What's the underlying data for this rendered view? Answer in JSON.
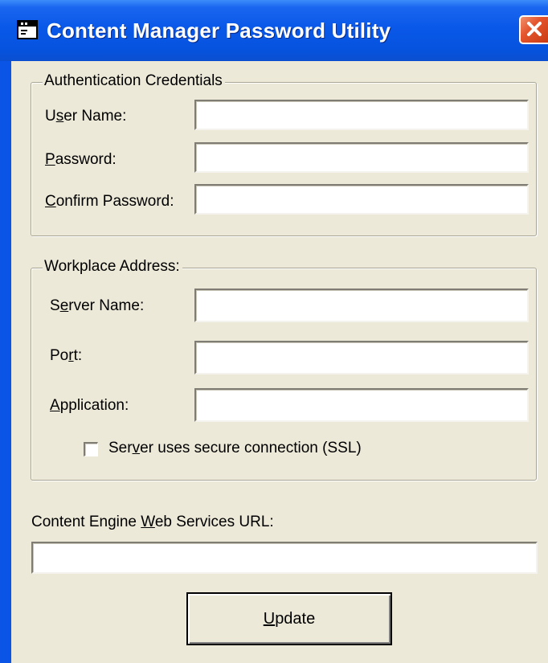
{
  "window": {
    "title": "Content Manager Password Utility",
    "icons": {
      "app": "window-app-icon",
      "close": "close-x-icon"
    },
    "colors": {
      "titlebar": "#0a58e8",
      "close_button": "#e4552e",
      "client": "#ece9d8"
    }
  },
  "auth_group": {
    "legend": "Authentication Credentials",
    "user_name": {
      "pre": "U",
      "key": "s",
      "post": "er Name:",
      "value": ""
    },
    "password": {
      "pre": "",
      "key": "P",
      "post": "assword:",
      "value": ""
    },
    "confirm_password": {
      "pre": "",
      "key": "C",
      "post": "onfirm Password:",
      "value": ""
    }
  },
  "workplace_group": {
    "legend": "Workplace Address:",
    "server_name": {
      "pre": "S",
      "key": "e",
      "post": "rver Name:",
      "value": ""
    },
    "port": {
      "pre": "Po",
      "key": "r",
      "post": "t:",
      "value": ""
    },
    "application": {
      "pre": "",
      "key": "A",
      "post": "pplication:",
      "value": ""
    },
    "ssl": {
      "pre": "Ser",
      "key": "v",
      "post": "er uses secure connection (SSL)",
      "checked": false
    }
  },
  "ce_url": {
    "pre": "Content Engine ",
    "key": "W",
    "post": "eb Services URL:",
    "value": ""
  },
  "update_button": {
    "pre": "",
    "key": "U",
    "post": "pdate"
  }
}
